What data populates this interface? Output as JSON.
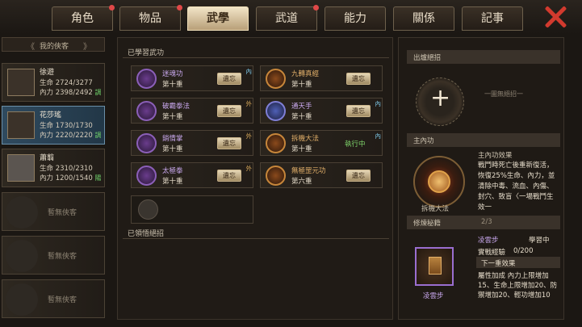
{
  "tabs": [
    {
      "label": "角色",
      "dot": true
    },
    {
      "label": "物品",
      "dot": true
    },
    {
      "label": "武學",
      "dot": false,
      "active": true
    },
    {
      "label": "武道",
      "dot": true
    },
    {
      "label": "能力",
      "dot": false
    },
    {
      "label": "關係",
      "dot": false
    },
    {
      "label": "記事",
      "dot": false
    }
  ],
  "roster": {
    "header": "我的俠客",
    "arrow_left": "《",
    "arrow_right": "》",
    "members": [
      {
        "name": "徐遊",
        "hp": "生命 2724/3277",
        "mp": "內力 2398/2492",
        "tag": "調"
      },
      {
        "name": "花莎瑤",
        "hp": "生命 1730/1730",
        "mp": "內力 2220/2220",
        "tag": "調"
      },
      {
        "name": "蕭翦",
        "hp": "生命 2310/2310",
        "mp": "內力 1200/1540",
        "tag": "陽"
      }
    ],
    "empty_label": "暫無俠客"
  },
  "learned": {
    "title": "已學習武功",
    "equip_label": "遺忘",
    "skills": [
      {
        "name": "迷魂功",
        "level": "第十重",
        "badge": "內",
        "style": "purple"
      },
      {
        "name": "九轉真經",
        "level": "第十重",
        "badge": "",
        "style": "gold"
      },
      {
        "name": "破霸拳法",
        "level": "第十重",
        "badge": "外",
        "style": "purple"
      },
      {
        "name": "通天手",
        "level": "第十重",
        "badge": "內",
        "style": "blue"
      },
      {
        "name": "銷情掌",
        "level": "第十重",
        "badge": "外",
        "style": "purple"
      },
      {
        "name": "拆機大法",
        "level": "第十重",
        "badge": "內",
        "style": "gold",
        "running": "執行中"
      },
      {
        "name": "太極拳",
        "level": "第十重",
        "badge": "外",
        "style": "purple"
      },
      {
        "name": "無極罡元功",
        "level": "第六重",
        "badge": "",
        "style": "gold"
      }
    ],
    "forgotten_title": "已領悟絕招"
  },
  "right": {
    "light_title": "出爐絕招",
    "none_equipped": "一圖無絕招一",
    "inner_title": "主內功",
    "inner_name": "拆機大法",
    "inner_effect_title": "主內功效果",
    "inner_effect": "戰鬥時死亡後重新復活，恢復25%生命、內力，並清除中毒、流血、內傷、封穴、致盲〈一場戰鬥生效一",
    "cultivate_title": "修煉秘籍",
    "cultivate_count": "2/3",
    "book_name": "凌雲步",
    "book_status": "學習中",
    "exp_label": "實戰經驗",
    "exp_value": "0/200",
    "next_label": "下一重效果",
    "attr_label": "屬性加成",
    "attr_text": "內力上限增加15、生命上限增加20、防禦增加20、輕功增加10"
  }
}
